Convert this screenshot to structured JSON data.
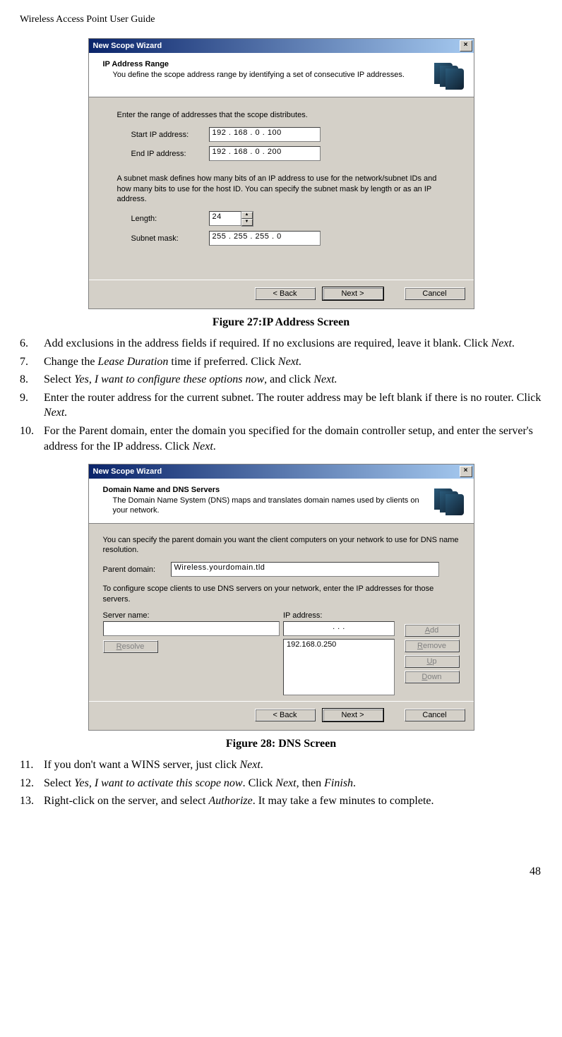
{
  "header": "Wireless Access Point User Guide",
  "pagenum": "48",
  "dialog1": {
    "title": "New Scope Wizard",
    "close": "×",
    "h_title": "IP Address Range",
    "h_sub": "You define the scope address range by identifying a set of consecutive IP addresses.",
    "intro": "Enter the range of addresses that the scope distributes.",
    "start_label": "Start IP address:",
    "start_value": "192 . 168 .   0   . 100",
    "end_label": "End IP address:",
    "end_value": "192 . 168 .   0   . 200",
    "mask_text": "A subnet mask defines how many bits of an IP address to use for the network/subnet IDs and how many bits to use for the host ID. You can specify the subnet mask by length or as an IP address.",
    "length_label": "Length:",
    "length_value": "24",
    "subnet_label": "Subnet mask:",
    "subnet_value": " 255 . 255 . 255 .   0",
    "back": "< Back",
    "next": "Next >",
    "cancel": "Cancel"
  },
  "fig27": "Figure 27:IP Address Screen",
  "list": {
    "i6": {
      "num": "6.",
      "text_a": "Add exclusions in the address fields if required. If no exclusions are required, leave it blank. Click ",
      "text_b": "Next",
      "text_c": "."
    },
    "i7": {
      "num": "7.",
      "text_a": "Change the ",
      "text_b": "Lease Duration",
      "text_c": " time if preferred. Click ",
      "text_d": "Next."
    },
    "i8": {
      "num": "8.",
      "text_a": "Select ",
      "text_b": "Yes, I want to configure these options now",
      "text_c": ", and click ",
      "text_d": "Next."
    },
    "i9": {
      "num": "9.",
      "text_a": "Enter the router address for the current subnet. The router address may be left blank if there is no router. Click ",
      "text_b": "Next."
    },
    "i10": {
      "num": "10.",
      "text_a": "For the Parent domain, enter the domain you specified for the domain controller setup, and enter the server's address for the IP address. Click ",
      "text_b": "Next",
      "text_c": "."
    },
    "i11": {
      "num": "11.",
      "text_a": "If you don't want a WINS server, just click ",
      "text_b": "Next",
      "text_c": "."
    },
    "i12": {
      "num": "12.",
      "text_a": "Select ",
      "text_b": "Yes, I want to activate this scope now",
      "text_c": ". Click ",
      "text_d": "Next",
      "text_e": ", then ",
      "text_f": "Finish",
      "text_g": "."
    },
    "i13": {
      "num": "13.",
      "text_a": "Right-click on the server, and select ",
      "text_b": "Authorize",
      "text_c": ". It may take a few minutes to complete."
    }
  },
  "dialog2": {
    "title": "New Scope Wizard",
    "close": "×",
    "h_title": "Domain Name and DNS Servers",
    "h_sub": "The Domain Name System (DNS) maps and translates domain names used by clients on your network.",
    "intro": "You can specify the parent domain you want the client computers on your network to use for DNS name resolution.",
    "parent_label": "Parent domain:",
    "parent_value": "Wireless.yourdomain.tld",
    "text2": "To configure scope clients to use DNS servers on your network, enter the IP addresses for those servers.",
    "server_label": "Server name:",
    "ip_label": "IP address:",
    "ip_blank": "    .        .        .",
    "ip_listed": "192.168.0.250",
    "resolve": "Resolve",
    "add": "Add",
    "remove": "Remove",
    "up": "Up",
    "down": "Down",
    "back": "< Back",
    "next": "Next >",
    "cancel": "Cancel"
  },
  "fig28": "Figure 28: DNS Screen"
}
